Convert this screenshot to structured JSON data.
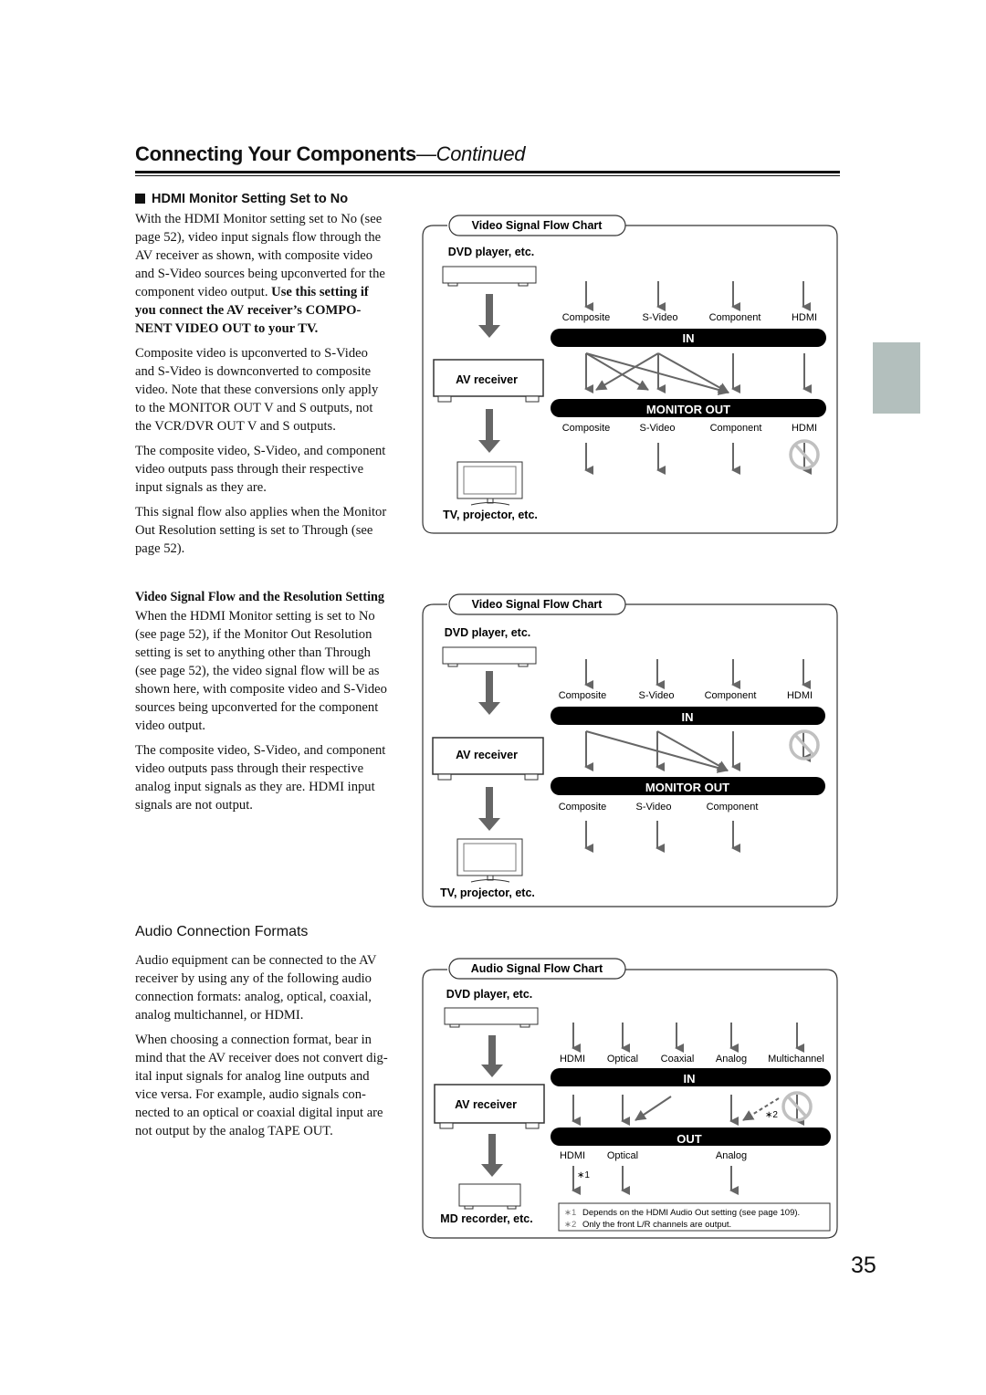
{
  "header": {
    "title": "Connecting Your Components",
    "title_suffix": "—Continued"
  },
  "section1": {
    "heading": "HDMI Monitor Setting Set to No",
    "para1_lines": [
      "With the HDMI Monitor setting set to No (see",
      "page 52), video input signals flow through the",
      "AV receiver as shown, with composite video",
      "and S-Video sources being upconverted for the"
    ],
    "para1_line5_plain": "component video output. ",
    "para1_line5_bold": "Use this setting if",
    "para1_bold_lines": [
      "you connect the AV receiver’s COMPO-",
      "NENT VIDEO OUT to your TV."
    ],
    "para2_lines": [
      "Composite video is upconverted to S-Video",
      "and S-Video is downconverted to composite",
      "video. Note that these conversions only apply",
      "to the MONITOR OUT V and S outputs, not",
      "the VCR/DVR OUT V and S outputs."
    ],
    "para3_lines": [
      "The composite video, S-Video, and component",
      "video outputs pass through their respective",
      "input signals as they are."
    ],
    "para4_lines": [
      "This signal flow also applies when the Monitor",
      "Out Resolution setting is set to Through (see",
      "page 52)."
    ]
  },
  "section2": {
    "subheading": "Video Signal Flow and the Resolution Setting",
    "para1_lines": [
      "When the HDMI Monitor setting is set to No",
      "(see page 52), if the Monitor Out Resolution",
      "setting is set to anything other than Through",
      "(see page 52), the video signal flow will be as",
      "shown here, with composite video and S-Video",
      "sources being upconverted for the component",
      "video output."
    ],
    "para2_lines": [
      "The composite video, S-Video, and component",
      "video outputs pass through their respective",
      "analog input signals as they are. HDMI input",
      "signals are not output."
    ]
  },
  "section3": {
    "heading": "Audio Connection Formats",
    "para1_lines": [
      "Audio equipment can be connected to the AV",
      "receiver by using any of the following audio",
      "connection formats: analog, optical, coaxial,",
      "analog multichannel, or HDMI."
    ],
    "para2_lines": [
      "When choosing a connection format, bear in",
      "mind that the AV receiver does not convert dig-",
      "ital input signals for analog line outputs and",
      "vice versa. For example, audio signals con-",
      "nected to an optical or coaxial digital input are",
      "not output by the analog TAPE OUT."
    ]
  },
  "diagram1": {
    "tab_label": "Video Signal Flow Chart",
    "source_label": "DVD player, etc.",
    "receiver_label": "AV receiver",
    "display_label": "TV, projector, etc.",
    "in_bar": "IN",
    "out_bar": "MONITOR OUT",
    "inputs": [
      "Composite",
      "S-Video",
      "Component",
      "HDMI"
    ],
    "outputs": [
      "Composite",
      "S-Video",
      "Component",
      "HDMI"
    ],
    "blocked": [
      "HDMI output"
    ]
  },
  "diagram2": {
    "tab_label": "Video Signal Flow Chart",
    "source_label": "DVD player, etc.",
    "receiver_label": "AV receiver",
    "display_label": "TV, projector, etc.",
    "in_bar": "IN",
    "out_bar": "MONITOR OUT",
    "inputs": [
      "Composite",
      "S-Video",
      "Component",
      "HDMI"
    ],
    "outputs": [
      "Composite",
      "S-Video",
      "Component"
    ],
    "blocked": [
      "HDMI input"
    ]
  },
  "diagram3": {
    "tab_label": "Audio Signal Flow Chart",
    "source_label": "DVD player, etc.",
    "receiver_label": "AV receiver",
    "display_label": "MD recorder, etc.",
    "in_bar": "IN",
    "out_bar": "OUT",
    "inputs": [
      "HDMI",
      "Optical",
      "Coaxial",
      "Analog",
      "Multichannel"
    ],
    "outputs": [
      "HDMI",
      "Optical",
      "Analog"
    ],
    "note_mark1": "∗1",
    "note_mark2": "∗2",
    "notes": [
      {
        "mark": "∗1",
        "text": "Depends on the HDMI Audio Out setting (see page 109)."
      },
      {
        "mark": "∗2",
        "text": "Only the front L/R channels are output."
      }
    ]
  },
  "page_number": "35",
  "colors": {
    "arrow": "#666666",
    "bar": "#000000",
    "prohibited": "#c0c0c0",
    "side_tab": "#b3bfbd"
  }
}
